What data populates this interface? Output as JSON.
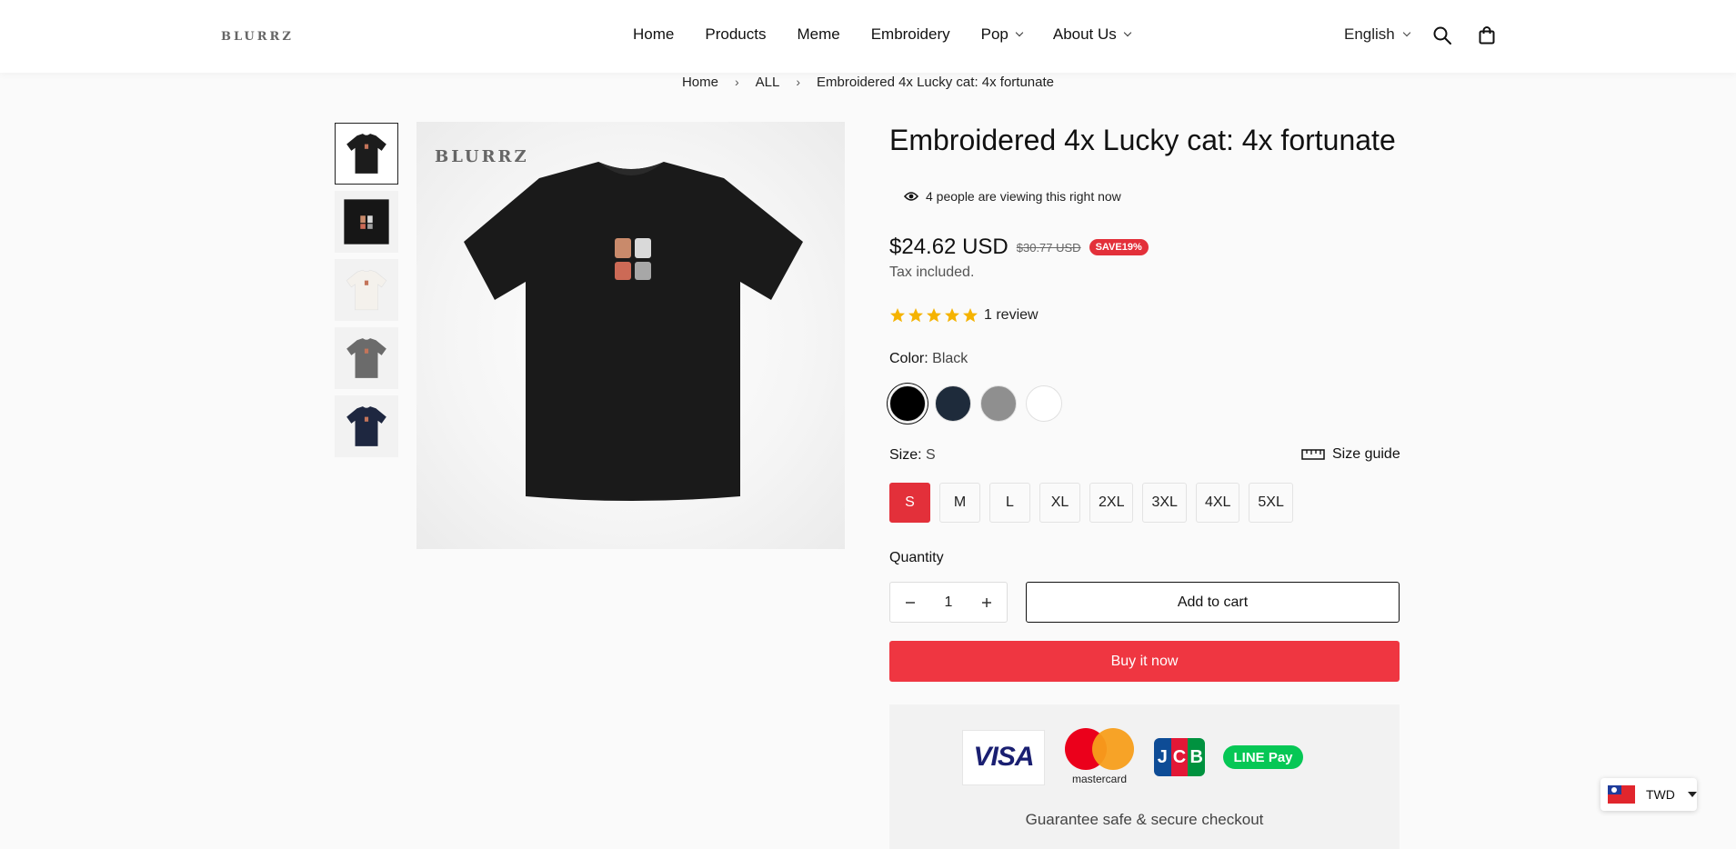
{
  "header": {
    "logo": "BLURRZ",
    "nav": [
      {
        "label": "Home",
        "dropdown": false
      },
      {
        "label": "Products",
        "dropdown": false
      },
      {
        "label": "Meme",
        "dropdown": false
      },
      {
        "label": "Embroidery",
        "dropdown": false
      },
      {
        "label": "Pop",
        "dropdown": true
      },
      {
        "label": "About Us",
        "dropdown": true
      }
    ],
    "language": "English",
    "icons": [
      "search-icon",
      "cart-icon"
    ]
  },
  "breadcrumb": [
    "Home",
    "ALL",
    "Embroidered 4x Lucky cat: 4x fortunate"
  ],
  "gallery": {
    "main_brand": "BLURRZ",
    "thumbnails": [
      {
        "color": "#1c1c1c",
        "active": true
      },
      {
        "color": "#161616",
        "active": false
      },
      {
        "color": "#f4f1ec",
        "active": false
      },
      {
        "color": "#6b6b6b",
        "active": false
      },
      {
        "color": "#1e2740",
        "active": false
      }
    ]
  },
  "product": {
    "title": "Embroidered 4x Lucky cat: 4x fortunate",
    "viewing": "4 people are viewing this right now",
    "price": "$24.62 USD",
    "compare_price": "$30.77 USD",
    "save_badge": "SAVE19%",
    "tax_note": "Tax included.",
    "rating": 5,
    "review_text": "1 review",
    "color_label": "Color:",
    "color_value": "Black",
    "colors": [
      {
        "name": "Black",
        "hex": "#000000",
        "active": true
      },
      {
        "name": "Navy",
        "hex": "#1e2b3b",
        "active": false
      },
      {
        "name": "Grey",
        "hex": "#8f8f8f",
        "active": false
      },
      {
        "name": "White",
        "hex": "#ffffff",
        "active": false
      }
    ],
    "size_label": "Size:",
    "size_value": "S",
    "size_guide": "Size guide",
    "sizes": [
      "S",
      "M",
      "L",
      "XL",
      "2XL",
      "3XL",
      "4XL",
      "5XL"
    ],
    "selected_size": "S",
    "quantity_label": "Quantity",
    "quantity": "1",
    "add_to_cart": "Add to cart",
    "buy_now": "Buy it now"
  },
  "payments": {
    "visa": "VISA",
    "mastercard": "mastercard",
    "jcb": [
      "J",
      "C",
      "B"
    ],
    "linepay": "LINE Pay",
    "guarantee": "Guarantee safe & secure checkout"
  },
  "currency": {
    "code": "TWD"
  },
  "colors": {
    "accent": "#ef3641",
    "badge": "#e3303a"
  }
}
